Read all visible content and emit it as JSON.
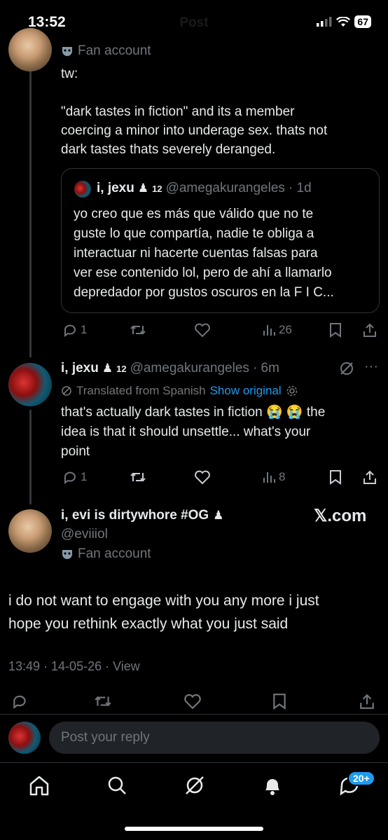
{
  "status_bar": {
    "time": "13:52",
    "battery": "67"
  },
  "header": {
    "title": "Post"
  },
  "tweet1": {
    "fan_label": "Fan account",
    "text_line1": "tw:",
    "text_line2": "\"dark tastes in fiction\" and its a member",
    "text_line3": "coercing a minor into underage sex. thats not",
    "text_line4": "dark tastes thats severely deranged.",
    "quote": {
      "name": "i, jexu",
      "sup": "12",
      "handle": "@amegakurangeles",
      "time": "· 1d",
      "line1": "yo creo que es más que válido que no te",
      "line2": "guste lo que compartía, nadie te obliga a",
      "line3": "interactuar ni hacerte cuentas falsas para",
      "line4": "ver ese contenido lol, pero de ahí a llamarlo",
      "line5": "depredador por gustos oscuros en la F I C..."
    },
    "replies": "1",
    "views": "26"
  },
  "tweet2": {
    "name": "i, jexu",
    "sup": "12",
    "handle": "@amegakurangeles",
    "time": "· 6m",
    "translated": "Translated from Spanish",
    "show_original": "Show original",
    "line1": "that's actually dark tastes in fiction 😭 😭  the",
    "line2": "idea is that it should unsettle... what's your",
    "line3": "point",
    "replies": "1",
    "views": "8"
  },
  "main_tweet": {
    "name": "i, evi is dirtywhore #OG",
    "handle": "@eviiiol",
    "fan_label": "Fan account",
    "watermark": "𝕏.com",
    "line1": "i do not want to engage with you any more i just",
    "line2": "hope you rethink exactly what you just said",
    "meta": "13:49 · 14-05-26 · View"
  },
  "reply": {
    "placeholder": "Post your reply"
  },
  "nav": {
    "badge": "20+"
  }
}
